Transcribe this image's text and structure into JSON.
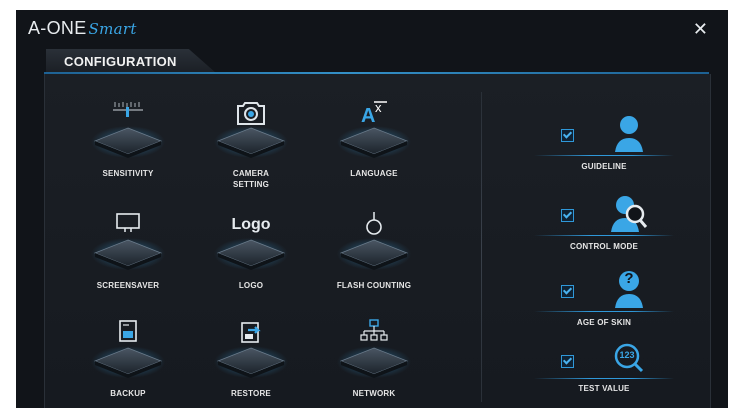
{
  "brand": {
    "name": "A-ONE",
    "suffix": "Smart"
  },
  "window": {
    "close_glyph": "✕"
  },
  "tab": {
    "label": "CONFIGURATION"
  },
  "grid": [
    {
      "label": "SENSITIVITY",
      "icon": "sensitivity-icon"
    },
    {
      "label": "CAMERA\nSETTING",
      "icon": "camera-icon"
    },
    {
      "label": "LANGUAGE",
      "icon": "language-icon"
    },
    {
      "label": "SCREENSAVER",
      "icon": "screensaver-icon"
    },
    {
      "label": "LOGO",
      "icon": "logo-icon",
      "icon_text": "Logo"
    },
    {
      "label": "FLASH COUNTING",
      "icon": "flask-icon"
    },
    {
      "label": "BACKUP",
      "icon": "backup-icon"
    },
    {
      "label": "RESTORE",
      "icon": "restore-icon"
    },
    {
      "label": "NETWORK",
      "icon": "network-icon"
    }
  ],
  "options": [
    {
      "label": "GUIDELINE",
      "checked": true,
      "icon": "person-icon"
    },
    {
      "label": "CONTROL MODE",
      "checked": true,
      "icon": "person-search-icon"
    },
    {
      "label": "AGE OF SKIN",
      "checked": true,
      "icon": "person-question-icon",
      "icon_text": "?"
    },
    {
      "label": "TEST VALUE",
      "checked": true,
      "icon": "test-value-icon",
      "icon_text": "123"
    }
  ],
  "colors": {
    "accent": "#2f98d9",
    "background": "#111419",
    "panel": "#1b1f25",
    "text": "#e6e6e6"
  }
}
